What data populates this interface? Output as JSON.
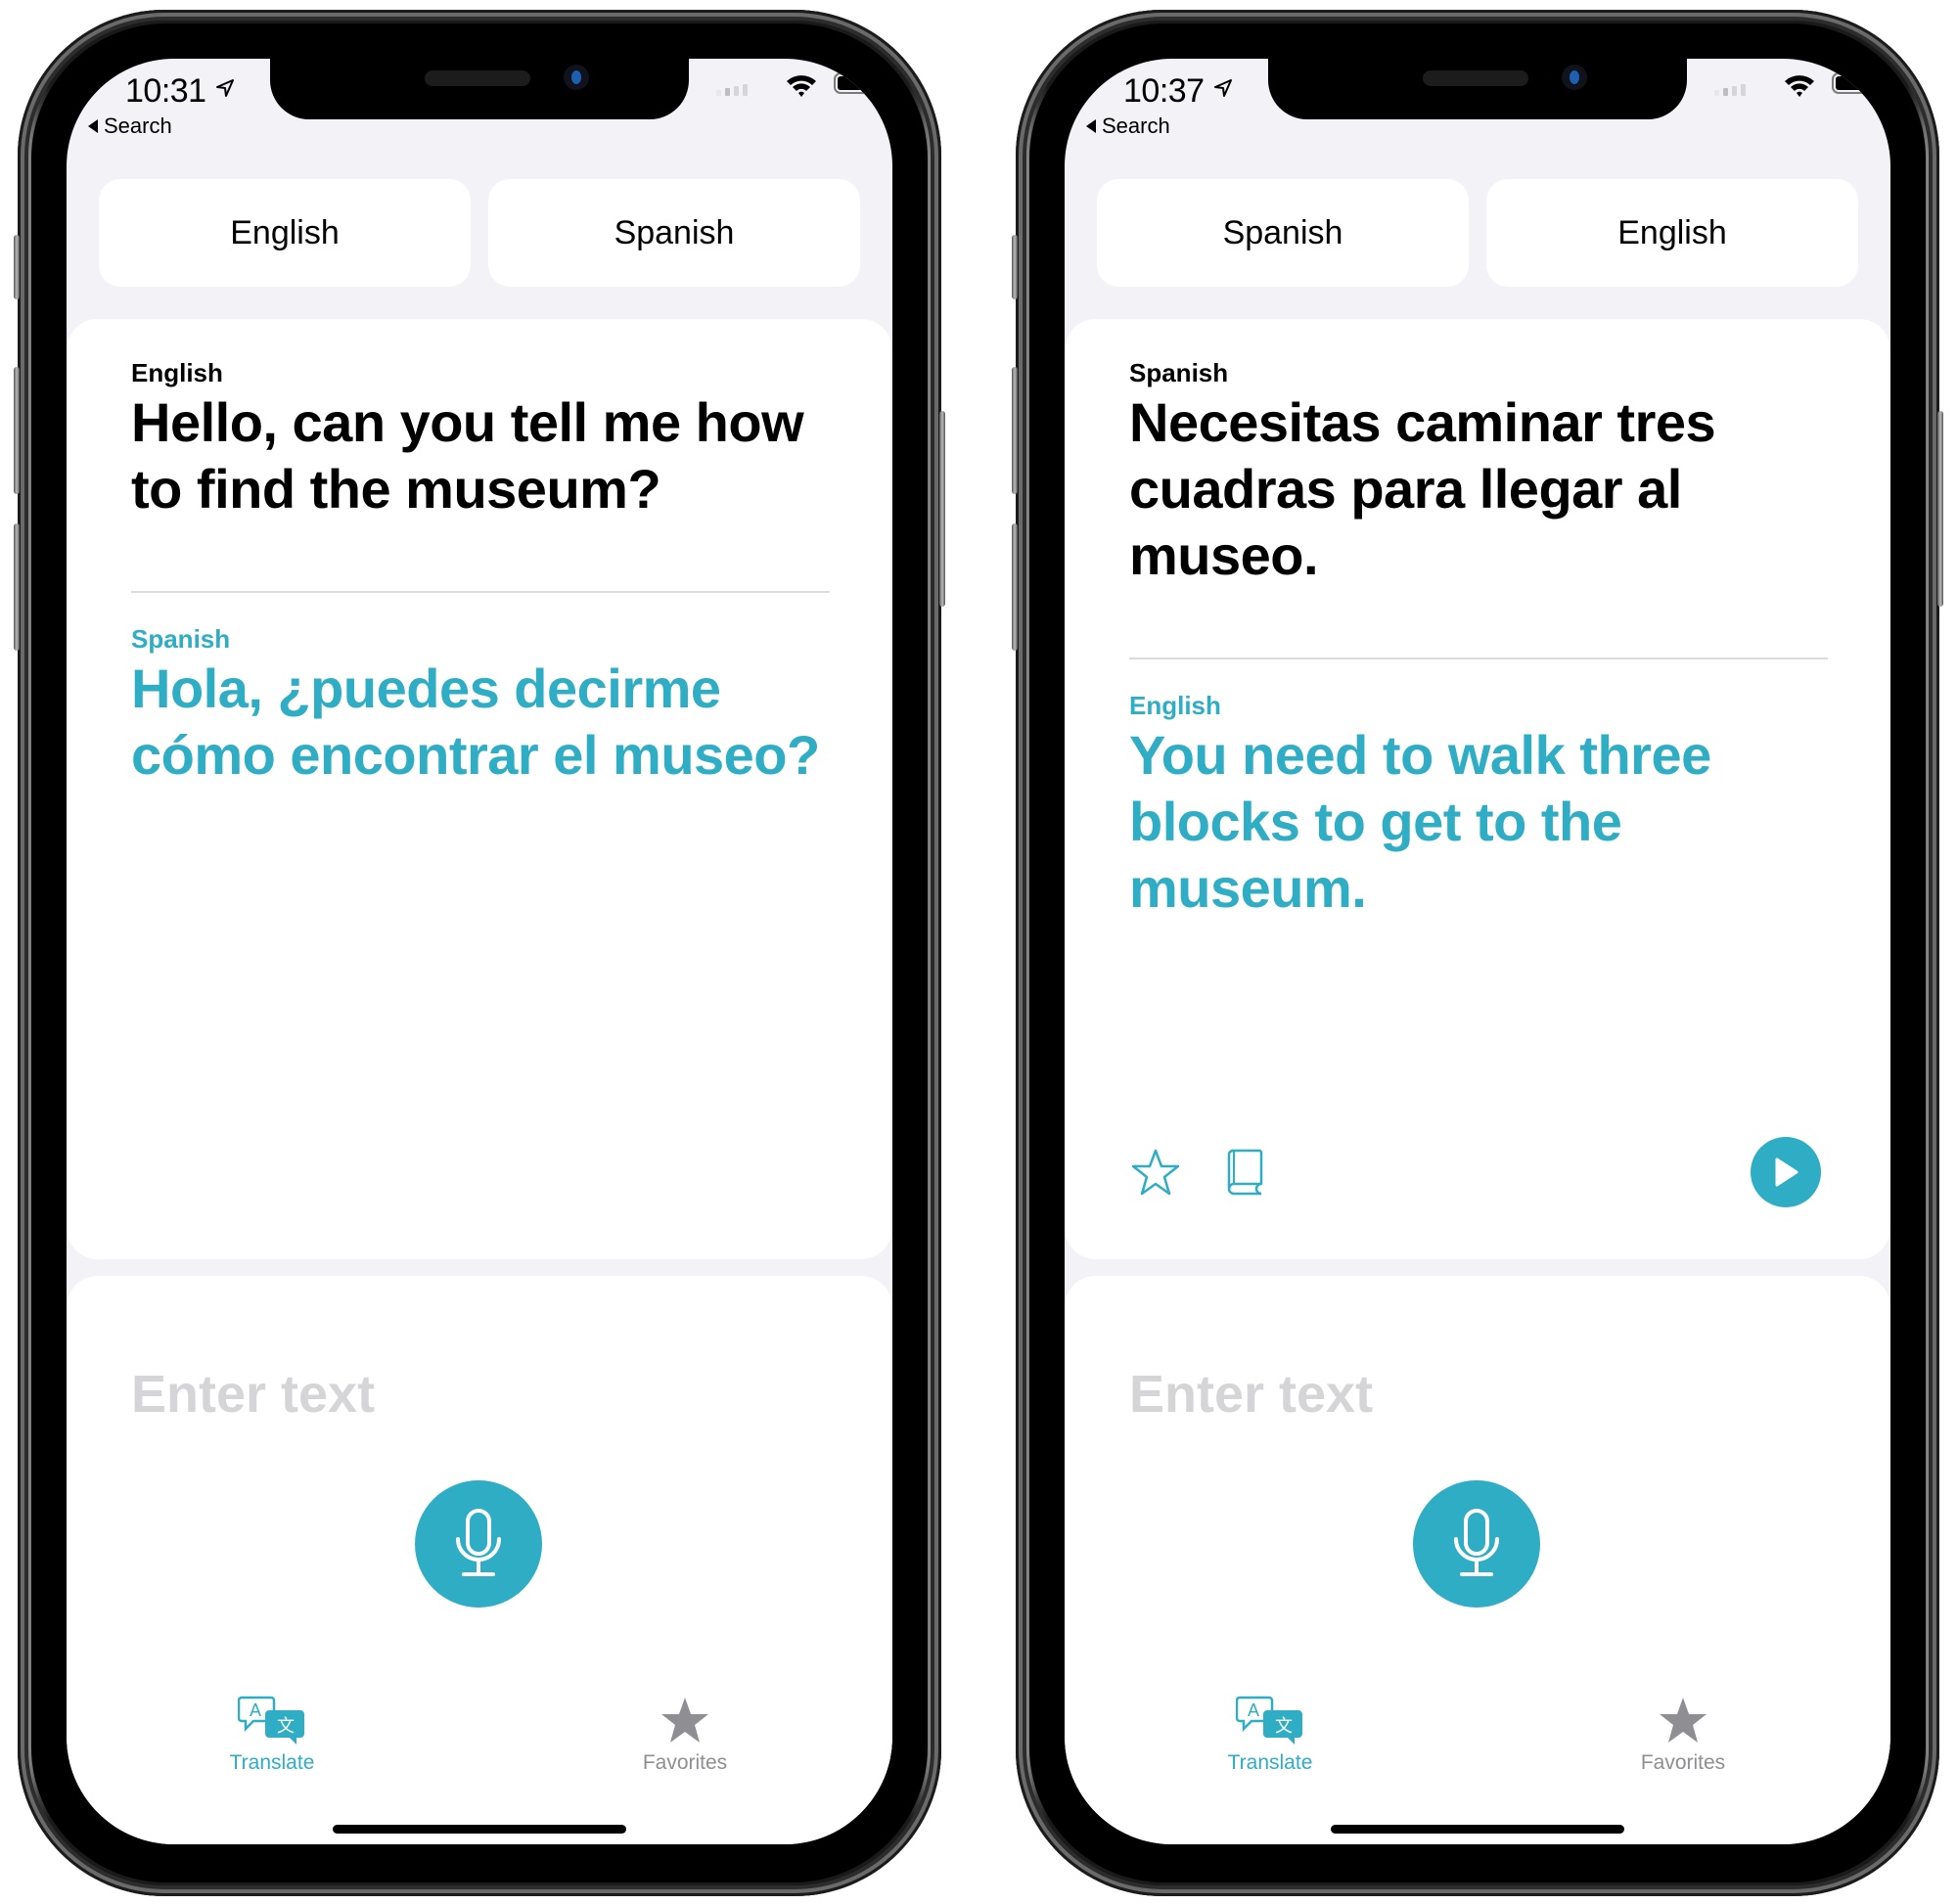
{
  "colors": {
    "accent": "#2eadc5",
    "background": "#f2f2f7",
    "card": "#ffffff",
    "placeholder": "#d5d5d8",
    "tab_inactive": "#8e8e93"
  },
  "phones": [
    {
      "status_bar": {
        "time": "10:31",
        "location_icon": "location-arrow-icon",
        "back_label": "Search",
        "wifi_icon": "wifi-icon",
        "battery_icon": "battery-icon",
        "signal_icon": "cellular-signal-icon"
      },
      "language_picker": {
        "source": "English",
        "target": "Spanish"
      },
      "translation": {
        "source_language": "English",
        "source_text": "Hello, can you tell me how to find the museum?",
        "target_language": "Spanish",
        "target_text": "Hola, ¿puedes decirme cómo encontrar el museo?"
      },
      "actions": null,
      "input": {
        "placeholder": "Enter text",
        "value": "",
        "mic_icon": "microphone-icon"
      },
      "tab_bar": {
        "tabs": [
          {
            "label": "Translate",
            "icon": "translate-icon",
            "active": true
          },
          {
            "label": "Favorites",
            "icon": "star-icon",
            "active": false
          }
        ]
      }
    },
    {
      "status_bar": {
        "time": "10:37",
        "location_icon": "location-arrow-icon",
        "back_label": "Search",
        "wifi_icon": "wifi-icon",
        "battery_icon": "battery-icon",
        "signal_icon": "cellular-signal-icon"
      },
      "language_picker": {
        "source": "Spanish",
        "target": "English"
      },
      "translation": {
        "source_language": "Spanish",
        "source_text": "Necesitas caminar tres cuadras para llegar al museo.",
        "target_language": "English",
        "target_text": "You need to walk three blocks to get to the museum."
      },
      "actions": {
        "favorite_icon": "star-outline-icon",
        "dictionary_icon": "book-icon",
        "play_icon": "play-icon"
      },
      "input": {
        "placeholder": "Enter text",
        "value": "",
        "mic_icon": "microphone-icon"
      },
      "tab_bar": {
        "tabs": [
          {
            "label": "Translate",
            "icon": "translate-icon",
            "active": true
          },
          {
            "label": "Favorites",
            "icon": "star-icon",
            "active": false
          }
        ]
      }
    }
  ]
}
